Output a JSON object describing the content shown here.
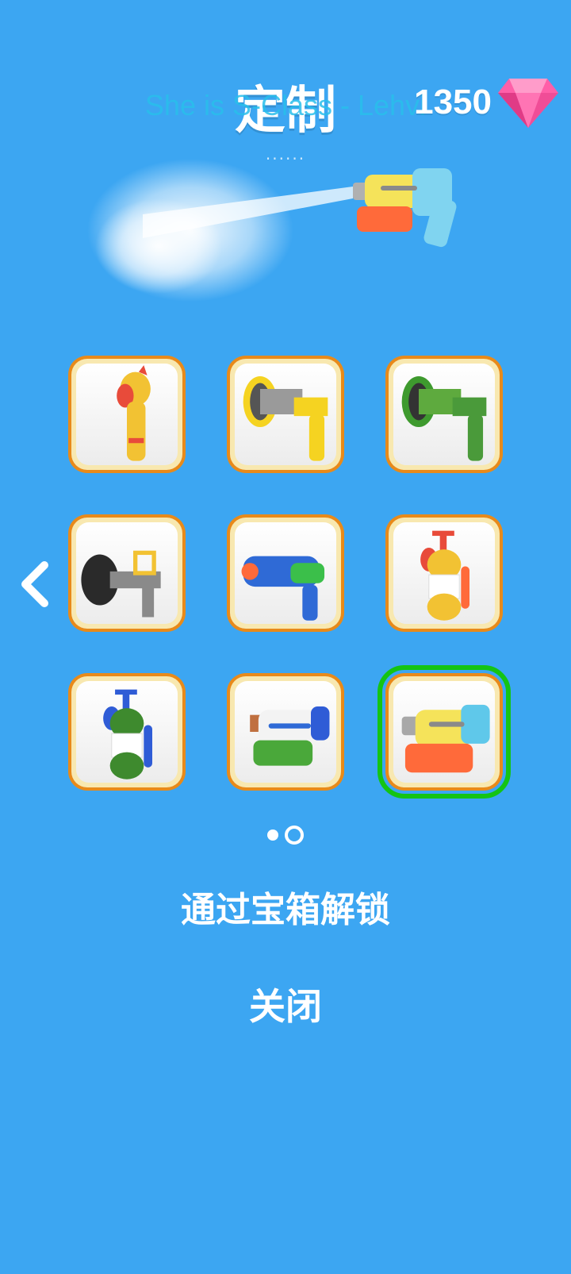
{
  "header": {
    "title": "定制",
    "overlay_text": "She is S-Class - Lehvi",
    "subtitle_dots": "......",
    "gems": "1350",
    "gem_icon": "pink-gem-icon"
  },
  "grid": {
    "items": [
      {
        "name": "rubber-chicken-sprayer",
        "icon": "rubber-chicken-icon"
      },
      {
        "name": "yellow-hose-nozzle",
        "icon": "yellow-nozzle-icon"
      },
      {
        "name": "green-hose-nozzle",
        "icon": "green-nozzle-icon"
      },
      {
        "name": "fire-hose-nozzle",
        "icon": "black-nozzle-icon"
      },
      {
        "name": "blue-water-pistol",
        "icon": "blue-pistol-icon"
      },
      {
        "name": "yellow-pump-sprayer",
        "icon": "yellow-pump-icon"
      },
      {
        "name": "green-pump-sprayer",
        "icon": "green-pump-icon"
      },
      {
        "name": "white-green-blaster",
        "icon": "white-blaster-icon"
      },
      {
        "name": "yellow-cyan-blaster",
        "icon": "yellow-blaster-icon",
        "selected": true
      }
    ],
    "prev_icon": "chevron-left-icon"
  },
  "pager": {
    "pages": 2,
    "current": 2
  },
  "unlock_label": "通过宝箱解锁",
  "close_label": "关闭",
  "colors": {
    "background": "#3ca6f2",
    "tile_border": "#e88a1a",
    "selected": "#14c414"
  }
}
